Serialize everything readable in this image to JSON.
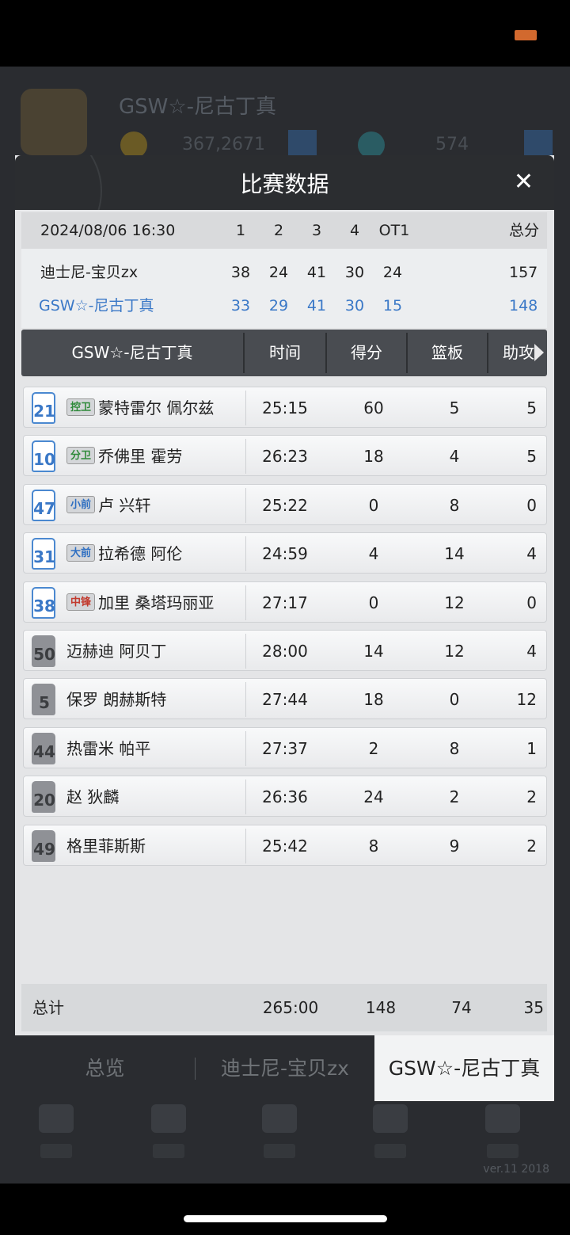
{
  "background": {
    "team_name": "GSW☆-尼古丁真",
    "coins": "367,2671",
    "gems": "574",
    "version": "ver.11  2018"
  },
  "dialog": {
    "title": "比赛数据",
    "close_label": "✕"
  },
  "scoreboard": {
    "datetime": "2024/08/06 16:30",
    "periods": [
      "1",
      "2",
      "3",
      "4",
      "OT1"
    ],
    "total_label": "总分",
    "teams": [
      {
        "name": "迪士尼-宝贝zx",
        "scores": [
          "38",
          "24",
          "41",
          "30",
          "24"
        ],
        "total": "157"
      },
      {
        "name": "GSW☆-尼古丁真",
        "scores": [
          "33",
          "29",
          "41",
          "30",
          "15"
        ],
        "total": "148"
      }
    ]
  },
  "stats_header": {
    "team": "GSW☆-尼古丁真",
    "columns": [
      "时间",
      "得分",
      "篮板",
      "助攻"
    ],
    "more_arrow_icon": "arrow-right-icon"
  },
  "players": [
    {
      "number": "21",
      "position": "控卫",
      "name": "蒙特雷尔 佩尔兹",
      "time": "25:15",
      "points": "60",
      "rebounds": "5",
      "assists": "5",
      "starter": true,
      "pos_color": "#2f8a3a"
    },
    {
      "number": "10",
      "position": "分卫",
      "name": "乔佛里 霍劳",
      "time": "26:23",
      "points": "18",
      "rebounds": "4",
      "assists": "5",
      "starter": true,
      "pos_color": "#2f8a3a"
    },
    {
      "number": "47",
      "position": "小前",
      "name": "卢 兴轩",
      "time": "25:22",
      "points": "0",
      "rebounds": "8",
      "assists": "0",
      "starter": true,
      "pos_color": "#2e6fc2"
    },
    {
      "number": "31",
      "position": "大前",
      "name": "拉希德 阿伦",
      "time": "24:59",
      "points": "4",
      "rebounds": "14",
      "assists": "4",
      "starter": true,
      "pos_color": "#2e6fc2"
    },
    {
      "number": "38",
      "position": "中锋",
      "name": "加里 桑塔玛丽亚",
      "time": "27:17",
      "points": "0",
      "rebounds": "12",
      "assists": "0",
      "starter": true,
      "pos_color": "#c23a2e"
    },
    {
      "number": "50",
      "position": "",
      "name": "迈赫迪 阿贝丁",
      "time": "28:00",
      "points": "14",
      "rebounds": "12",
      "assists": "4",
      "starter": false,
      "pos_color": ""
    },
    {
      "number": "5",
      "position": "",
      "name": "保罗 朗赫斯特",
      "time": "27:44",
      "points": "18",
      "rebounds": "0",
      "assists": "12",
      "starter": false,
      "pos_color": ""
    },
    {
      "number": "44",
      "position": "",
      "name": "热雷米 帕平",
      "time": "27:37",
      "points": "2",
      "rebounds": "8",
      "assists": "1",
      "starter": false,
      "pos_color": ""
    },
    {
      "number": "20",
      "position": "",
      "name": "赵 狄麟",
      "time": "26:36",
      "points": "24",
      "rebounds": "2",
      "assists": "2",
      "starter": false,
      "pos_color": ""
    },
    {
      "number": "49",
      "position": "",
      "name": "格里菲斯斯",
      "time": "25:42",
      "points": "8",
      "rebounds": "9",
      "assists": "2",
      "starter": false,
      "pos_color": ""
    }
  ],
  "totals": {
    "label": "总计",
    "time": "265:00",
    "points": "148",
    "rebounds": "74",
    "assists": "35"
  },
  "tabs": [
    {
      "label": "总览",
      "active": false
    },
    {
      "label": "迪士尼-宝贝zx",
      "active": false
    },
    {
      "label": "GSW☆-尼古丁真",
      "active": true
    }
  ]
}
